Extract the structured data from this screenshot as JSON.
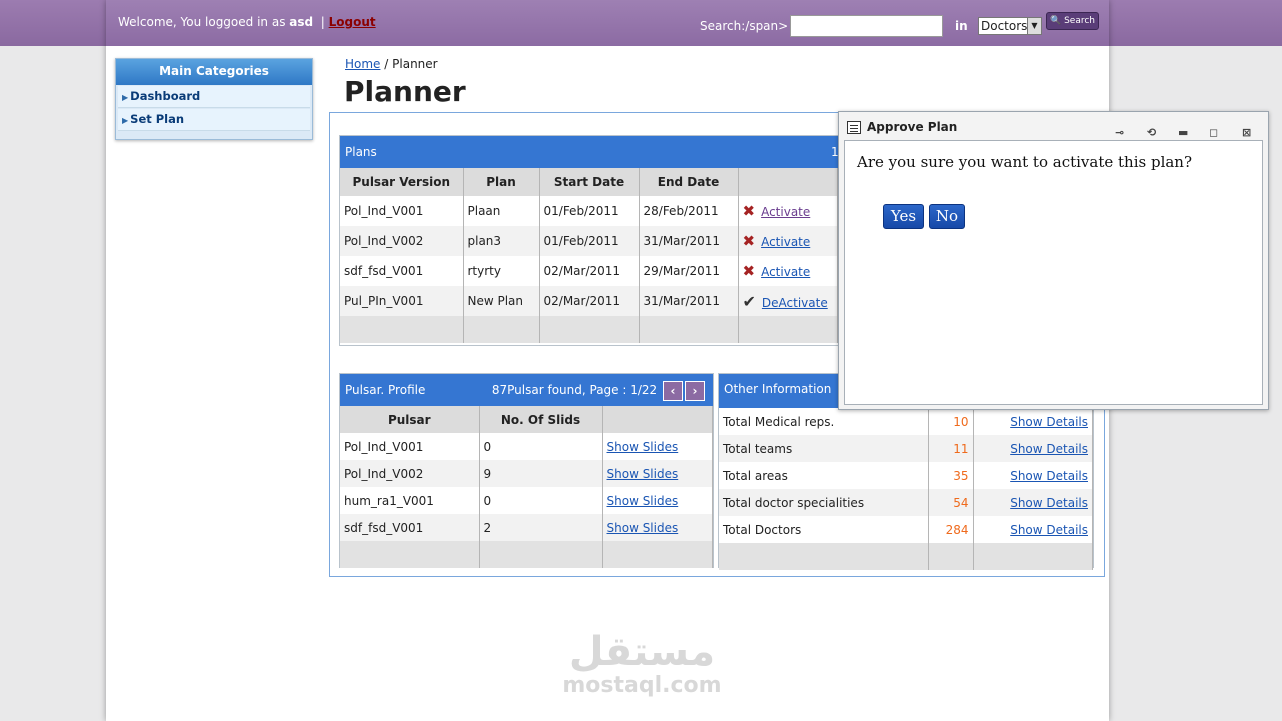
{
  "header": {
    "welcome_prefix": "Welcome, You loggoed in as",
    "username": "asd",
    "separator": "|",
    "logout_label": "Logout",
    "search_label": "Search:/span>",
    "search_value": "",
    "in_label": "in",
    "search_scope": "Doctors",
    "search_button": "Search"
  },
  "sidebar": {
    "title": "Main Categories",
    "items": [
      {
        "label": "Dashboard"
      },
      {
        "label": "Set Plan"
      }
    ]
  },
  "breadcrumb": {
    "home": "Home",
    "sep": "/",
    "current": "Planner"
  },
  "page_title": "Planner",
  "plans": {
    "title": "Plans",
    "count_text": "1",
    "columns": [
      "Pulsar Version",
      "Plan",
      "Start Date",
      "End Date",
      ""
    ],
    "rows": [
      {
        "version": "Pol_Ind_V001",
        "plan": "Plaan",
        "start": "01/Feb/2011",
        "end": "28/Feb/2011",
        "status": "inactive",
        "action": "Activate"
      },
      {
        "version": "Pol_Ind_V002",
        "plan": "plan3",
        "start": "01/Feb/2011",
        "end": "31/Mar/2011",
        "status": "inactive",
        "action": "Activate"
      },
      {
        "version": "sdf_fsd_V001",
        "plan": "rtyrty",
        "start": "02/Mar/2011",
        "end": "29/Mar/2011",
        "status": "inactive",
        "action": "Activate"
      },
      {
        "version": "Pul_PIn_V001",
        "plan": "New Plan",
        "start": "02/Mar/2011",
        "end": "31/Mar/2011",
        "status": "active",
        "action": "DeActivate"
      }
    ]
  },
  "profile": {
    "title": "Pulsar. Profile",
    "pager_text": "87Pulsar found, Page : 1/22",
    "columns": [
      "Pulsar",
      "No. Of Slids",
      ""
    ],
    "rows": [
      {
        "pulsar": "Pol_Ind_V001",
        "slides": "0",
        "link": "Show Slides"
      },
      {
        "pulsar": "Pol_Ind_V002",
        "slides": "9",
        "link": "Show Slides"
      },
      {
        "pulsar": "hum_ra1_V001",
        "slides": "0",
        "link": "Show Slides"
      },
      {
        "pulsar": "sdf_fsd_V001",
        "slides": "2",
        "link": "Show Slides"
      }
    ]
  },
  "other_info": {
    "title": "Other Information",
    "rows": [
      {
        "label": "Total Medical reps.",
        "value": "10",
        "link": "Show Details"
      },
      {
        "label": "Total teams",
        "value": "11",
        "link": "Show Details"
      },
      {
        "label": "Total areas",
        "value": "35",
        "link": "Show Details"
      },
      {
        "label": "Total doctor specialities",
        "value": "54",
        "link": "Show Details"
      },
      {
        "label": "Total Doctors",
        "value": "284",
        "link": "Show Details"
      }
    ]
  },
  "dialog": {
    "title": "Approve Plan",
    "message": "Are you sure you want to activate this plan?",
    "yes_label": "Yes",
    "no_label": "No"
  },
  "watermark": {
    "arabic": "مستقل",
    "latin": "mostaql.com"
  },
  "colors": {
    "header_purple": "#8c6ba3",
    "panel_blue": "#3576d2",
    "link_blue": "#1a55b3",
    "number_orange": "#ef6a1c"
  }
}
